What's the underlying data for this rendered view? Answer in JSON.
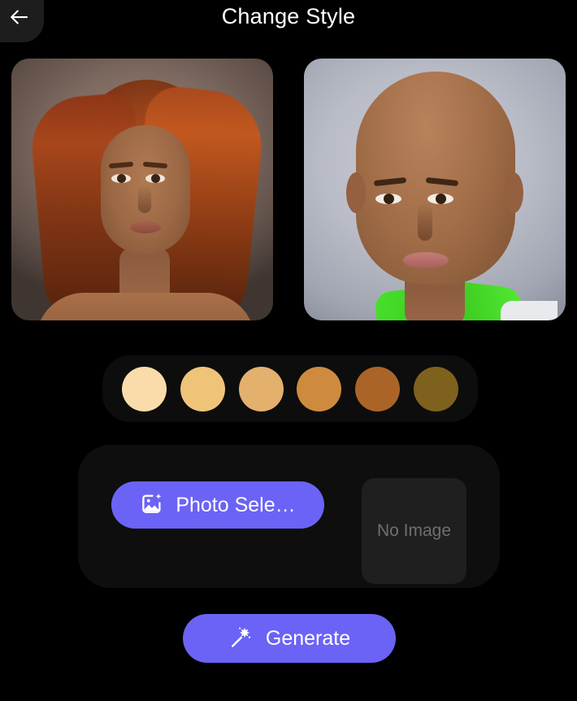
{
  "header": {
    "title": "Change Style",
    "back_icon": "arrow-left-icon"
  },
  "previews": [
    {
      "name": "original-portrait",
      "alt": "Woman with long auburn hair, warm gray-brown studio backdrop"
    },
    {
      "name": "styled-portrait",
      "alt": "Bald smiling woman with green top, pale blue-gray studio backdrop"
    }
  ],
  "skin_tones": {
    "label": "Skin tone swatches",
    "swatches": [
      {
        "name": "tone-1",
        "color": "#FADCAB"
      },
      {
        "name": "tone-2",
        "color": "#F0C478"
      },
      {
        "name": "tone-3",
        "color": "#E3B06E"
      },
      {
        "name": "tone-4",
        "color": "#CE8B3E"
      },
      {
        "name": "tone-5",
        "color": "#AB6428"
      },
      {
        "name": "tone-6",
        "color": "#7E611C"
      }
    ]
  },
  "photo_panel": {
    "select_button": {
      "label": "Photo Sele…",
      "icon": "image-sparkle-icon",
      "color": "#6B63F5"
    },
    "preview": {
      "placeholder": "No Image"
    }
  },
  "generate": {
    "label": "Generate",
    "icon": "magic-wand-icon",
    "color": "#6B63F5"
  },
  "theme": {
    "background": "#000000",
    "accent": "#6B63F5",
    "panel": "#0E0E0E",
    "text": "#FFFFFF"
  }
}
